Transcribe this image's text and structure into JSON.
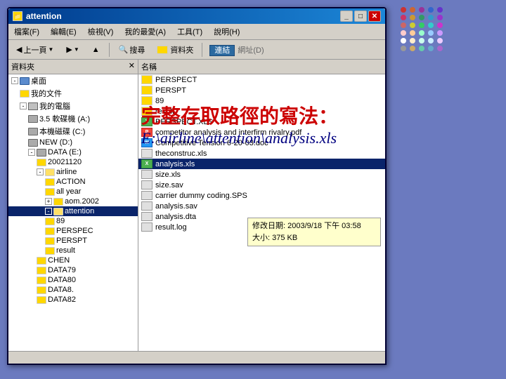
{
  "window": {
    "title": "attention",
    "titlebar_icon": "📁"
  },
  "menubar": {
    "items": [
      "檔案(F)",
      "編輯(E)",
      "檢視(V)",
      "我的最愛(A)",
      "工具(T)",
      "說明(H)"
    ]
  },
  "toolbar": {
    "back_label": "上一頁",
    "search_label": "搜尋",
    "folder_label": "資料夾",
    "connect_label": "連結",
    "address_label": "網址(D)"
  },
  "sidebar": {
    "header": "資料夾",
    "close_label": "✕",
    "items": [
      {
        "label": "桌面",
        "indent": 1,
        "expand": "-"
      },
      {
        "label": "我的文件",
        "indent": 2
      },
      {
        "label": "我的電腦",
        "indent": 2,
        "expand": "-"
      },
      {
        "label": "3.5 軟碟機 (A:)",
        "indent": 3
      },
      {
        "label": "本機磁碟 (C:)",
        "indent": 3
      },
      {
        "label": "NEW (D:)",
        "indent": 3
      },
      {
        "label": "DATA (E:)",
        "indent": 3,
        "expand": "-"
      },
      {
        "label": "20021120",
        "indent": 4
      },
      {
        "label": "airline",
        "indent": 4,
        "expand": "-"
      },
      {
        "label": "ACTION",
        "indent": 5
      },
      {
        "label": "all year",
        "indent": 5
      },
      {
        "label": "aom.2002",
        "indent": 5,
        "expand": "+"
      },
      {
        "label": "attention",
        "indent": 5,
        "expand": "-",
        "selected": true
      },
      {
        "label": "89",
        "indent": 5
      },
      {
        "label": "PERSPEC",
        "indent": 5
      },
      {
        "label": "PERSPT",
        "indent": 5
      },
      {
        "label": "result",
        "indent": 5
      },
      {
        "label": "CHEN",
        "indent": 4
      },
      {
        "label": "DATA79",
        "indent": 4
      },
      {
        "label": "DATA80",
        "indent": 4
      },
      {
        "label": "DATA8.",
        "indent": 4
      },
      {
        "label": "DATA82",
        "indent": 4
      }
    ]
  },
  "filelist": {
    "header": "名稱",
    "items": [
      {
        "type": "folder",
        "name": "PERSPECT"
      },
      {
        "type": "folder",
        "name": "PERSPT"
      },
      {
        "type": "folder",
        "name": "89"
      },
      {
        "type": "folder",
        "name": "result"
      },
      {
        "type": "xls",
        "name": "PERSPECT.XLS"
      },
      {
        "type": "pdf",
        "name": "competitor analysis and interfirm rivalry.pdf"
      },
      {
        "type": "doc",
        "name": "Competitive Tension 6-20-03.doc"
      },
      {
        "type": "generic",
        "name": "theconstruc.xls"
      },
      {
        "type": "xls",
        "name": "analysis.xls",
        "selected": true
      },
      {
        "type": "generic",
        "name": "size.xls"
      },
      {
        "type": "generic",
        "name": "size.sav"
      },
      {
        "type": "generic",
        "name": "carrier dummy coding.SPS"
      },
      {
        "type": "generic",
        "name": "analysis.sav"
      },
      {
        "type": "generic",
        "name": "analysis.dta"
      },
      {
        "type": "generic",
        "name": "result.log"
      }
    ]
  },
  "tooltip": {
    "date_label": "修改日期: 2003/9/18 下午 03:58",
    "size_label": "大小: 375 KB"
  },
  "overlay": {
    "chinese_text": "完整存取路徑的寫法：",
    "path_text": "E:\\airline\\attention\\analysis.xls"
  },
  "dots": [
    "#cc3333",
    "#cc6633",
    "#993399",
    "#3366cc",
    "#6633cc",
    "#cc3366",
    "#cc9933",
    "#339966",
    "#3399cc",
    "#9933cc",
    "#cc6666",
    "#cccc33",
    "#33cc66",
    "#33cccc",
    "#cc33cc",
    "#ffcccc",
    "#ffcc99",
    "#99ffcc",
    "#99ccff",
    "#cc99ff",
    "#ffffff",
    "#ffeecc",
    "#ccffee",
    "#cceeff",
    "#eeccff",
    "#999999",
    "#ccaa66",
    "#66ccaa",
    "#66aacc",
    "#aa66cc"
  ],
  "titlebar_buttons": {
    "minimize": "_",
    "maximize": "□",
    "close": "✕"
  }
}
